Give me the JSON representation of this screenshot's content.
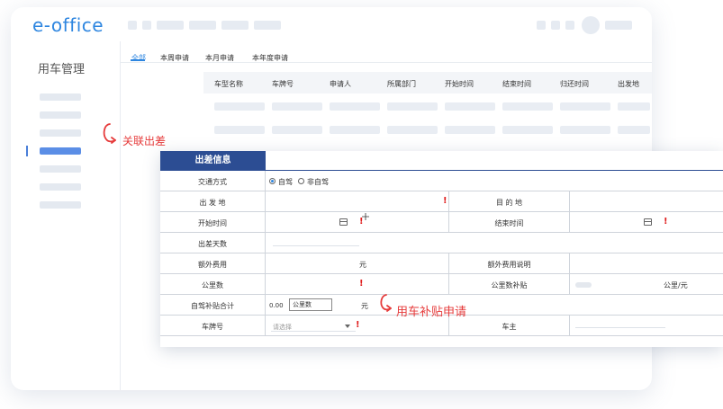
{
  "app": {
    "logo": "e-office"
  },
  "sidebar": {
    "title": "用车管理"
  },
  "tabs": [
    {
      "label": "全部",
      "active": true
    },
    {
      "label": "本周申请",
      "active": false
    },
    {
      "label": "本月申请",
      "active": false
    },
    {
      "label": "本年度申请",
      "active": false
    }
  ],
  "table": {
    "columns": [
      "车型名称",
      "车牌号",
      "申请人",
      "所属部门",
      "开始时间",
      "结束时间",
      "归还时间",
      "出发地"
    ]
  },
  "annotations": {
    "link_trip": "关联出差",
    "car_subsidy": "用车补贴申请"
  },
  "form": {
    "title": "出差信息",
    "transport_label": "交通方式",
    "transport_option_self": "自驾",
    "transport_option_other": "非自驾",
    "departure_label": "出 发 地",
    "destination_label": "目 的 地",
    "start_label": "开始时间",
    "end_label": "结束时间",
    "days_label": "出差天数",
    "extra_fee_label": "额外费用",
    "extra_fee_unit": "元",
    "extra_fee_desc_label": "额外费用说明",
    "km_label": "公里数",
    "km_subsidy_label": "公里数补贴",
    "km_subsidy_unit": "公里/元",
    "self_drive_total_label": "自驾补贴合计",
    "self_drive_total_value": "0.00",
    "self_drive_km_button": "公里数",
    "self_drive_total_unit": "元",
    "plate_label": "车牌号",
    "plate_placeholder": "请选择",
    "owner_label": "车主"
  },
  "colors": {
    "accent": "#2e86e0",
    "header": "#2c4d93",
    "required": "#e02020",
    "annotation": "#e63b3b"
  }
}
